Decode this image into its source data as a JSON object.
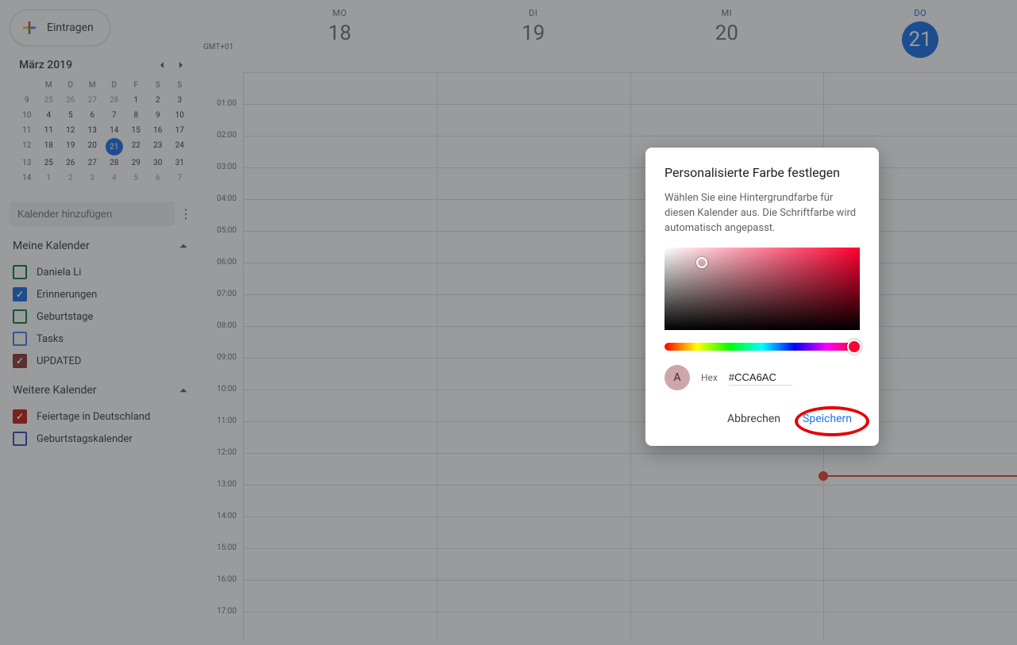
{
  "create_label": "Eintragen",
  "minical": {
    "month": "März 2019",
    "dow": [
      "M",
      "D",
      "M",
      "D",
      "F",
      "S",
      "S"
    ],
    "weeks": [
      {
        "wk": "9",
        "days": [
          "25",
          "26",
          "27",
          "28",
          "1",
          "2",
          "3"
        ],
        "other": [
          0,
          1,
          2,
          3
        ]
      },
      {
        "wk": "10",
        "days": [
          "4",
          "5",
          "6",
          "7",
          "8",
          "9",
          "10"
        ]
      },
      {
        "wk": "11",
        "days": [
          "11",
          "12",
          "13",
          "14",
          "15",
          "16",
          "17"
        ]
      },
      {
        "wk": "12",
        "days": [
          "18",
          "19",
          "20",
          "21",
          "22",
          "23",
          "24"
        ],
        "today": 3
      },
      {
        "wk": "13",
        "days": [
          "25",
          "26",
          "27",
          "28",
          "29",
          "30",
          "31"
        ]
      },
      {
        "wk": "14",
        "days": [
          "1",
          "2",
          "3",
          "4",
          "5",
          "6",
          "7"
        ],
        "other": [
          0,
          1,
          2,
          3,
          4,
          5,
          6
        ]
      }
    ]
  },
  "add_cal_placeholder": "Kalender hinzufügen",
  "sections": {
    "mine": {
      "title": "Meine Kalender",
      "items": [
        {
          "label": "Daniela Li",
          "color": "#0b8043",
          "checked": false
        },
        {
          "label": "Erinnerungen",
          "color": "#1a73e8",
          "checked": true
        },
        {
          "label": "Geburtstage",
          "color": "#0b8043",
          "checked": false
        },
        {
          "label": "Tasks",
          "color": "#4285f4",
          "checked": false
        },
        {
          "label": "UPDATED",
          "color": "#8e3b3b",
          "checked": true
        }
      ]
    },
    "other": {
      "title": "Weitere Kalender",
      "items": [
        {
          "label": "Feiertage in Deutschland",
          "color": "#c5221f",
          "checked": true
        },
        {
          "label": "Geburtstagskalender",
          "color": "#3f51b5",
          "checked": false
        }
      ]
    }
  },
  "timezone": "GMT+01",
  "days": [
    {
      "dow": "MO",
      "num": "18"
    },
    {
      "dow": "DI",
      "num": "19"
    },
    {
      "dow": "MI",
      "num": "20"
    },
    {
      "dow": "DO",
      "num": "21",
      "active": true
    }
  ],
  "hours": [
    "01:00",
    "02:00",
    "03:00",
    "04:00",
    "05:00",
    "06:00",
    "07:00",
    "08:00",
    "09:00",
    "10:00",
    "11:00",
    "12:00",
    "13:00",
    "14:00",
    "15:00",
    "16:00",
    "17:00"
  ],
  "dialog": {
    "title": "Personalisierte Farbe festlegen",
    "desc": "Wählen Sie eine Hintergrundfarbe für diesen Kalender aus. Die Schriftfarbe wird automatisch angepasst.",
    "preview_letter": "A",
    "hex_label": "Hex",
    "hex_value": "#CCA6AC",
    "cancel": "Abbrechen",
    "save": "Speichern"
  }
}
